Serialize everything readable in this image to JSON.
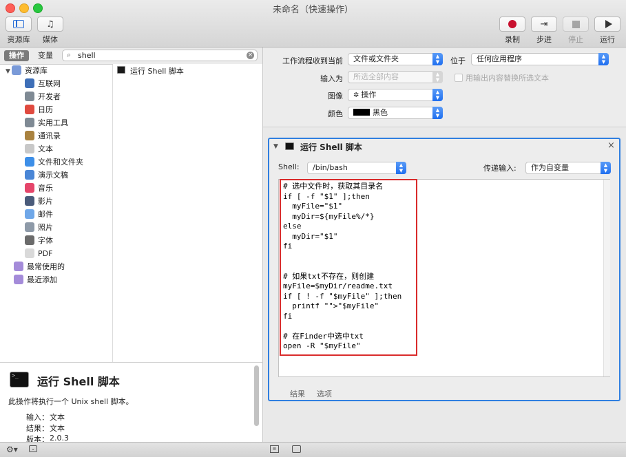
{
  "window": {
    "title": "未命名（快速操作）"
  },
  "toolbar": {
    "library_label": "资源库",
    "media_label": "媒体",
    "record_label": "录制",
    "step_label": "步进",
    "stop_label": "停止",
    "run_label": "运行"
  },
  "left": {
    "tabs": [
      "操作",
      "变量"
    ],
    "search_value": "shell",
    "library": [
      {
        "label": "资源库",
        "icon": "library-icon",
        "color": "#7a9ad8"
      },
      {
        "label": "互联网",
        "icon": "globe-icon",
        "color": "#3e6fb8"
      },
      {
        "label": "开发者",
        "icon": "tools-icon",
        "color": "#7f8a94"
      },
      {
        "label": "日历",
        "icon": "calendar-icon",
        "color": "#e04a3f"
      },
      {
        "label": "实用工具",
        "icon": "utilities-icon",
        "color": "#7f8a94"
      },
      {
        "label": "通讯录",
        "icon": "contacts-icon",
        "color": "#a9823f"
      },
      {
        "label": "文本",
        "icon": "text-icon",
        "color": "#c8c8c8"
      },
      {
        "label": "文件和文件夹",
        "icon": "finder-icon",
        "color": "#3d8fe8"
      },
      {
        "label": "演示文稿",
        "icon": "presentation-icon",
        "color": "#4a86d6"
      },
      {
        "label": "音乐",
        "icon": "music-icon",
        "color": "#e5456a"
      },
      {
        "label": "影片",
        "icon": "movie-icon",
        "color": "#4a5b7a"
      },
      {
        "label": "邮件",
        "icon": "mail-icon",
        "color": "#6fa7e8"
      },
      {
        "label": "照片",
        "icon": "photos-icon",
        "color": "#8e9aa8"
      },
      {
        "label": "字体",
        "icon": "font-icon",
        "color": "#6b6b6b"
      },
      {
        "label": "PDF",
        "icon": "pdf-icon",
        "color": "#d9d9d9"
      },
      {
        "label": "最常使用的",
        "icon": "smart-folder-icon",
        "color": "#a48bd9"
      },
      {
        "label": "最近添加",
        "icon": "smart-folder-icon",
        "color": "#a48bd9"
      }
    ],
    "result_item": "运行 Shell 脚本",
    "description": {
      "title": "运行 Shell 脚本",
      "summary": "此操作将执行一个 Unix shell 脚本。",
      "input_label": "输入：",
      "input_value": "文本",
      "result_label": "结果：",
      "result_value": "文本",
      "version_label": "版本：",
      "version_value": "2.0.3"
    }
  },
  "workflow": {
    "receives_label": "工作流程收到当前",
    "receives_value": "文件或文件夹",
    "in_label": "位于",
    "in_value": "任何应用程序",
    "input_is_label": "输入为",
    "input_is_value": "所选全部内容",
    "replace_label": "用输出内容替换所选文本",
    "image_label": "图像",
    "image_value": "操作",
    "color_label": "颜色",
    "color_value": "黑色",
    "color_swatch": "#000000"
  },
  "action": {
    "title": "运行 Shell 脚本",
    "shell_label": "Shell:",
    "shell_value": "/bin/bash",
    "pass_input_label": "传递输入:",
    "pass_input_value": "作为自变量",
    "code_lines": [
      "# 选中文件时，获取其目录名",
      "if [ -f \"$1\" ];then",
      "  myFile=\"$1\"",
      "  myDir=${myFile%/*}",
      "else",
      "  myDir=\"$1\"",
      "fi",
      "",
      "",
      "# 如果txt不存在，则创建",
      "myFile=$myDir/readme.txt",
      "if [ ! -f \"$myFile\" ];then",
      "  printf \"\">\"$myFile\"",
      "fi",
      "",
      "# 在Finder中选中txt",
      "open -R \"$myFile\""
    ],
    "tab_results": "结果",
    "tab_options": "选项"
  }
}
